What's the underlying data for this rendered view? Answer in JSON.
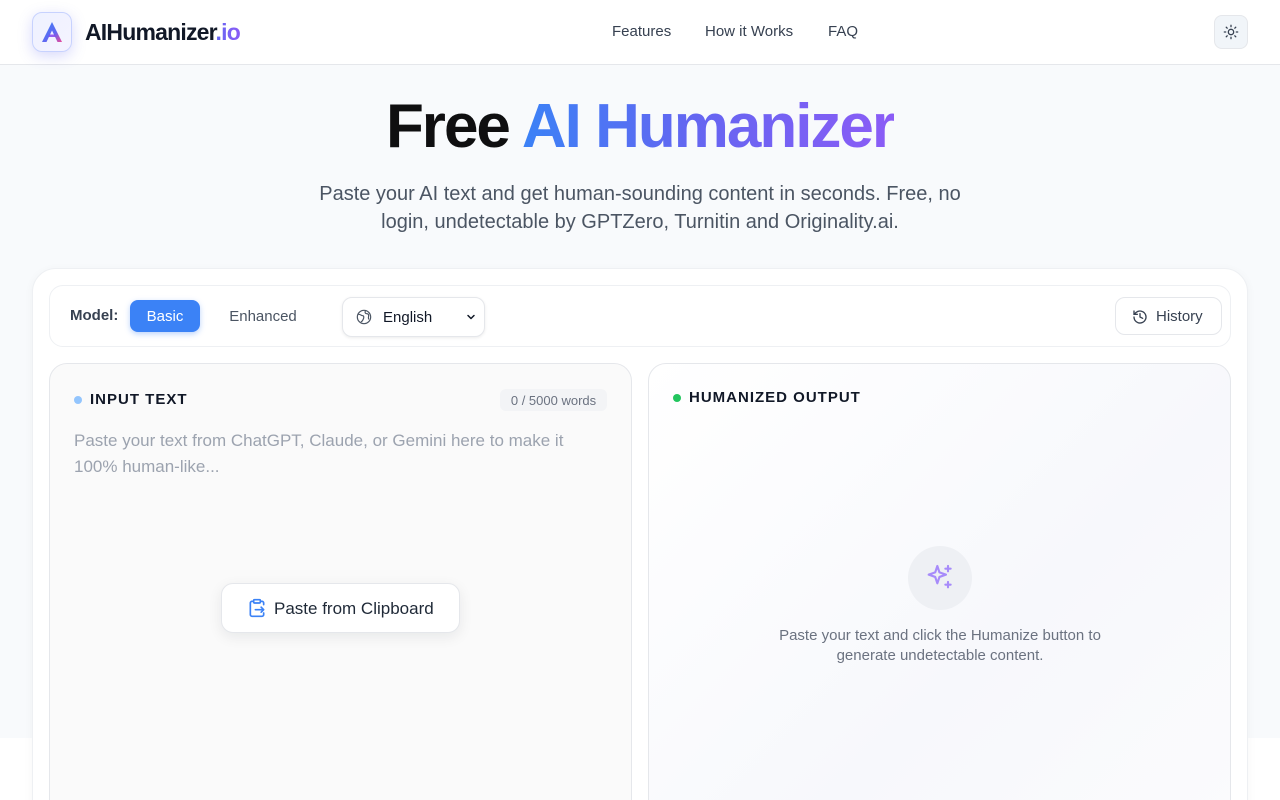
{
  "header": {
    "brand_main": "AIHumanizer",
    "brand_tld": ".io",
    "nav": [
      {
        "label": "Features"
      },
      {
        "label": "How it Works"
      },
      {
        "label": "FAQ"
      }
    ]
  },
  "hero": {
    "title_plain": "Free",
    "title_gradient": "AI Humanizer",
    "subtitle": "Paste your AI text and get human-sounding content in seconds. Free, no login, undetectable by GPTZero, Turnitin and Originality.ai."
  },
  "toolbar": {
    "model_label": "Model:",
    "model_options": [
      "Basic",
      "Enhanced"
    ],
    "selected_model": "Basic",
    "language": "English",
    "history_label": "History"
  },
  "input_panel": {
    "label": "INPUT TEXT",
    "word_count": "0 / 5000 words",
    "placeholder": "Paste your text from ChatGPT, Claude, or Gemini here to make it 100% human-like...",
    "paste_button": "Paste from Clipboard"
  },
  "output_panel": {
    "label": "HUMANIZED OUTPUT",
    "empty_hint": "Paste your text and click the Humanize button to generate undetectable content."
  },
  "colors": {
    "accent_blue": "#3b82f6",
    "accent_indigo": "#6366f1",
    "accent_violet": "#8b5cf6",
    "status_green": "#22c55e"
  },
  "icons": {
    "logo": "triangle-a-logo-icon",
    "theme": "sun-icon",
    "language": "globe-icon",
    "dropdown": "chevron-down-icon",
    "history": "history-clock-icon",
    "paste": "clipboard-icon",
    "output_empty": "sparkles-icon"
  }
}
